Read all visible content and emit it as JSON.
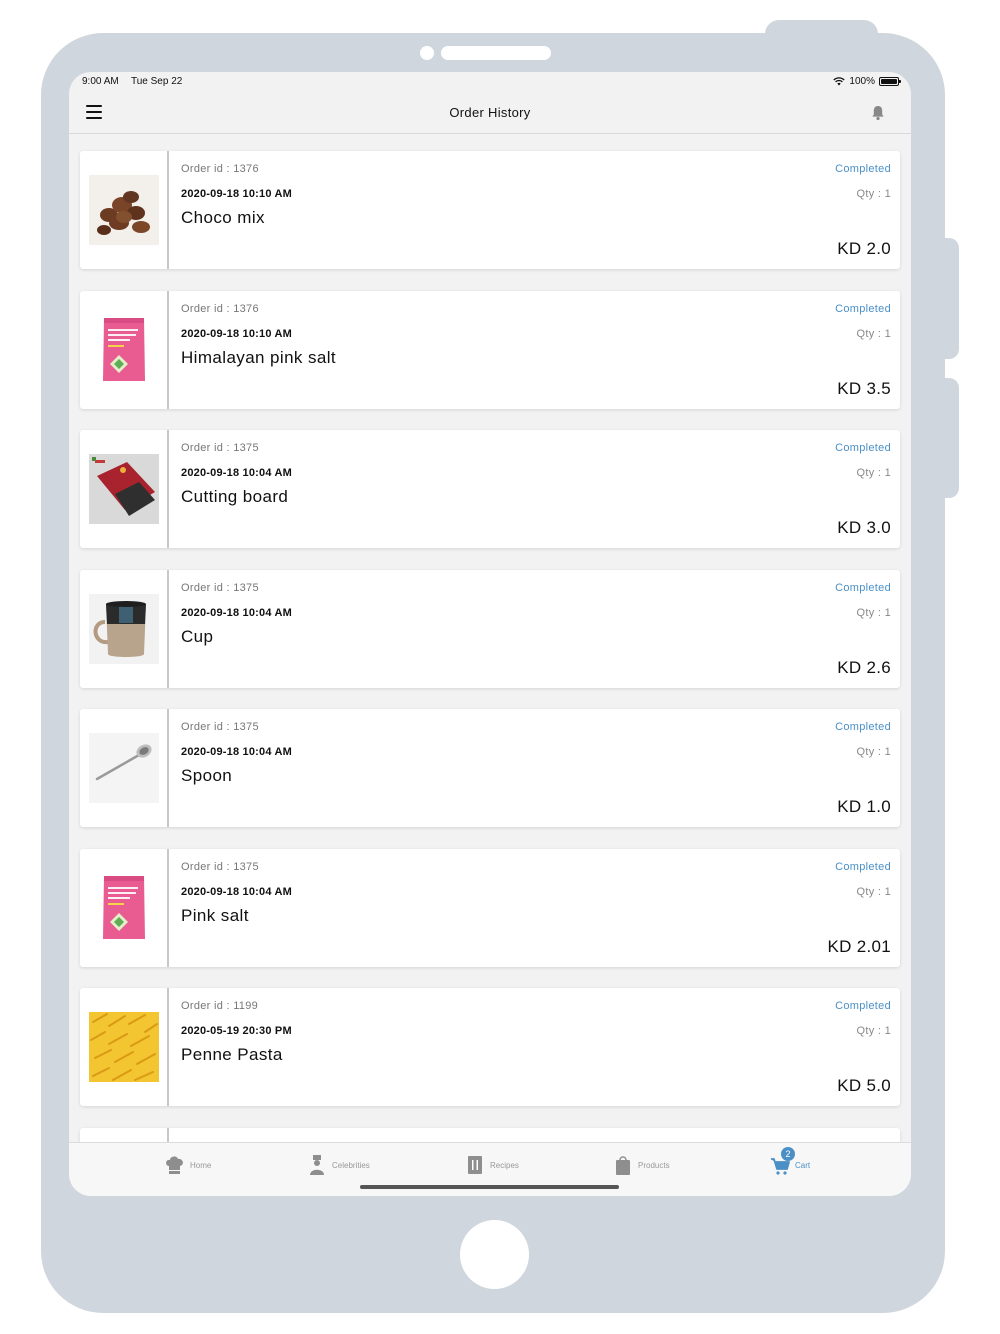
{
  "status_bar": {
    "time": "9:00 AM",
    "date": "Tue Sep 22",
    "battery": "100%"
  },
  "nav": {
    "title": "Order History"
  },
  "orders": [
    {
      "order_id": "Order id : 1376",
      "date": "2020-09-18 10:10 AM",
      "name": "Choco mix",
      "status": "Completed",
      "qty": "Qty : 1",
      "price": "KD 2.0",
      "image": "chocolate-chips"
    },
    {
      "order_id": "Order id : 1376",
      "date": "2020-09-18 10:10 AM",
      "name": "Himalayan pink salt",
      "status": "Completed",
      "qty": "Qty : 1",
      "price": "KD 3.5",
      "image": "pink-salt-pouch"
    },
    {
      "order_id": "Order id : 1375",
      "date": "2020-09-18 10:04 AM",
      "name": "Cutting board",
      "status": "Completed",
      "qty": "Qty : 1",
      "price": "KD 3.0",
      "image": "cutting-boards"
    },
    {
      "order_id": "Order id : 1375",
      "date": "2020-09-18 10:04 AM",
      "name": "Cup",
      "status": "Completed",
      "qty": "Qty : 1",
      "price": "KD 2.6",
      "image": "mug"
    },
    {
      "order_id": "Order id : 1375",
      "date": "2020-09-18 10:04 AM",
      "name": "Spoon",
      "status": "Completed",
      "qty": "Qty : 1",
      "price": "KD 1.0",
      "image": "spoon"
    },
    {
      "order_id": "Order id : 1375",
      "date": "2020-09-18 10:04 AM",
      "name": "Pink salt",
      "status": "Completed",
      "qty": "Qty : 1",
      "price": "KD 2.01",
      "image": "pink-salt-pouch"
    },
    {
      "order_id": "Order id : 1199",
      "date": "2020-05-19 20:30 PM",
      "name": "Penne Pasta",
      "status": "Completed",
      "qty": "Qty : 1",
      "price": "KD 5.0",
      "image": "penne-pasta"
    }
  ],
  "tabs": [
    {
      "label": "Home",
      "icon": "chef-hat-icon",
      "active": false
    },
    {
      "label": "Celebrities",
      "icon": "chef-person-icon",
      "active": false
    },
    {
      "label": "Recipes",
      "icon": "recipe-book-icon",
      "active": false
    },
    {
      "label": "Products",
      "icon": "shopping-bag-icon",
      "active": false
    },
    {
      "label": "Cart",
      "icon": "cart-icon",
      "active": true,
      "badge": "2"
    }
  ],
  "colors": {
    "accent": "#4a90c7",
    "frame": "#cfd6dd",
    "screen_bg": "#f2f2f2"
  }
}
